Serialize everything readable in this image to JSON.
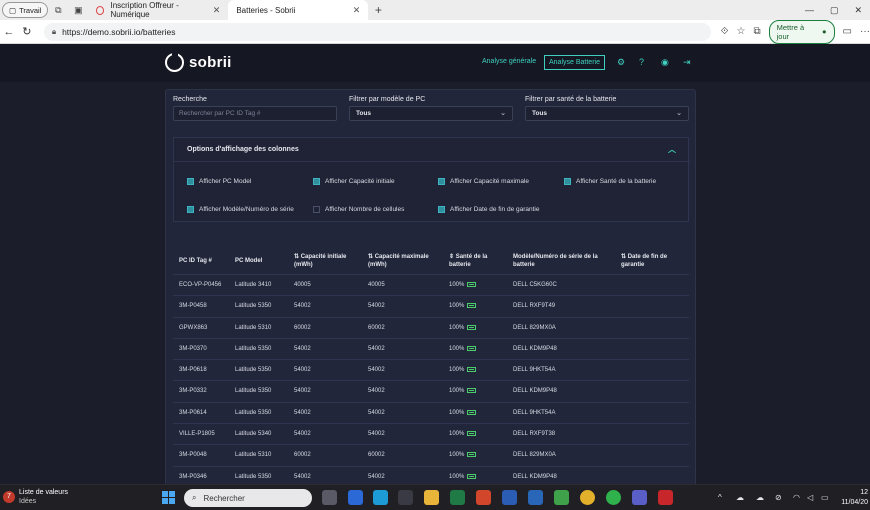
{
  "browser": {
    "profile_label": "Travail",
    "tabs": [
      {
        "title": "Inscription Offreur - Numérique"
      },
      {
        "title": "Batteries - Sobrii"
      }
    ],
    "url": "https://demo.sobrii.io/batteries",
    "update_button": "Mettre à jour"
  },
  "app": {
    "logo_text": "sobrii",
    "nav": {
      "general": "Analyse générale",
      "battery": "Analyse Batterie"
    }
  },
  "filters": {
    "search_label": "Recherche",
    "search_placeholder": "Rechercher par PC ID Tag #",
    "model_label": "Filtrer par modèle de PC",
    "model_value": "Tous",
    "health_label": "Filtrer par santé de la batterie",
    "health_value": "Tous"
  },
  "options": {
    "title": "Options d'affichage des colonnes",
    "items": [
      {
        "label": "Afficher PC Model",
        "checked": true
      },
      {
        "label": "Afficher Capacité initiale",
        "checked": true
      },
      {
        "label": "Afficher Capacité maximale",
        "checked": true
      },
      {
        "label": "Afficher Santé de la batterie",
        "checked": true
      },
      {
        "label": "Afficher Modèle/Numéro de série",
        "checked": true
      },
      {
        "label": "Afficher Nombre de cellules",
        "checked": false
      },
      {
        "label": "Afficher Date de fin de garantie",
        "checked": true
      }
    ]
  },
  "table": {
    "headers": {
      "id": "PC ID Tag #",
      "model": "PC Model",
      "cap_init": "⇅ Capacité initiale (mWh)",
      "cap_max": "⇅ Capacité maximale (mWh)",
      "health": "⇕ Santé de la batterie",
      "serial": "Modèle/Numéro de série de la batterie",
      "warranty": "⇅ Date de fin de garantie"
    },
    "rows": [
      {
        "id": "ECO-VP-P0456",
        "model": "Latitude 3410",
        "cap_init": "40005",
        "cap_max": "40005",
        "health": "100%",
        "serial": "DELL C5KG60C"
      },
      {
        "id": "3M-P0458",
        "model": "Latitude 5350",
        "cap_init": "54002",
        "cap_max": "54002",
        "health": "100%",
        "serial": "DELL RXF9T49"
      },
      {
        "id": "GPWX863",
        "model": "Latitude 5310",
        "cap_init": "60002",
        "cap_max": "60002",
        "health": "100%",
        "serial": "DELL 829MX0A"
      },
      {
        "id": "3M-P0370",
        "model": "Latitude 5350",
        "cap_init": "54002",
        "cap_max": "54002",
        "health": "100%",
        "serial": "DELL KDM9P48"
      },
      {
        "id": "3M-P0618",
        "model": "Latitude 5350",
        "cap_init": "54002",
        "cap_max": "54002",
        "health": "100%",
        "serial": "DELL 9HKT54A"
      },
      {
        "id": "3M-P0332",
        "model": "Latitude 5350",
        "cap_init": "54002",
        "cap_max": "54002",
        "health": "100%",
        "serial": "DELL KDM9P48"
      },
      {
        "id": "3M-P0614",
        "model": "Latitude 5350",
        "cap_init": "54002",
        "cap_max": "54002",
        "health": "100%",
        "serial": "DELL 9HKT54A"
      },
      {
        "id": "VILLE-P1805",
        "model": "Latitude 5340",
        "cap_init": "54002",
        "cap_max": "54002",
        "health": "100%",
        "serial": "DELL RXF9T38"
      },
      {
        "id": "3M-P0048",
        "model": "Latitude 5310",
        "cap_init": "60002",
        "cap_max": "60002",
        "health": "100%",
        "serial": "DELL 829MX0A"
      },
      {
        "id": "3M-P0346",
        "model": "Latitude 5350",
        "cap_init": "54002",
        "cap_max": "54002",
        "health": "100%",
        "serial": "DELL KDM9P48"
      }
    ]
  },
  "taskbar": {
    "news_badge": "7",
    "news_title": "Liste de valeurs",
    "news_sub": "Idées",
    "search_label": "Rechercher",
    "time": "12",
    "date": "11/04/20"
  },
  "colors": {
    "accent": "#3fd1c0",
    "background": "#1b1d2a",
    "panel": "#22263a"
  }
}
